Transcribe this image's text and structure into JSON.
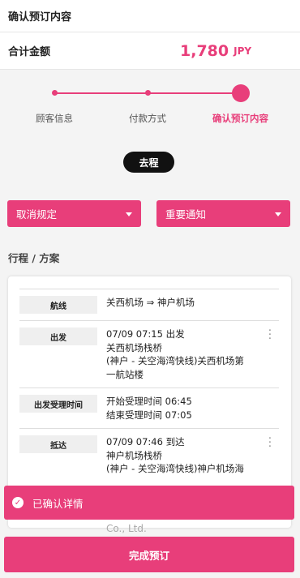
{
  "header": {
    "title": "确认预订内容"
  },
  "total": {
    "label": "合计金额",
    "amount": "1,780",
    "currency": "JPY"
  },
  "steps": [
    {
      "label": "顾客信息",
      "active": false
    },
    {
      "label": "付款方式",
      "active": false
    },
    {
      "label": "确认预订内容",
      "active": true
    }
  ],
  "trip_badge": "去程",
  "buttons": {
    "cancel_policy": "取消规定",
    "important_notice": "重要通知"
  },
  "section_title": "行程 / 方案",
  "itinerary": {
    "route": {
      "key": "航线",
      "lines": [
        "关西机场 ⇒ 神户机场"
      ]
    },
    "departure": {
      "key": "出发",
      "lines": [
        "07/09 07:15 出发",
        "关西机场栈桥",
        "(神户 - 关空海湾快线)关西机场第",
        "一航站楼"
      ]
    },
    "checkin": {
      "key": "出发受理时间",
      "lines": [
        "开始受理时间 06:45",
        "结束受理时间 07:05"
      ]
    },
    "arrival": {
      "key": "抵达",
      "lines": [
        "07/09 07:46 到达",
        "神户机场栈桥",
        "(神户 - 关空海湾快线)神户机场海"
      ]
    }
  },
  "overflow_text": {
    "line1": "Co., Ltd."
  },
  "confirm_bar": {
    "label": "已确认详情"
  },
  "complete_button": {
    "label": "完成预订"
  },
  "colors": {
    "accent": "#e83e7a",
    "badge": "#111111"
  }
}
